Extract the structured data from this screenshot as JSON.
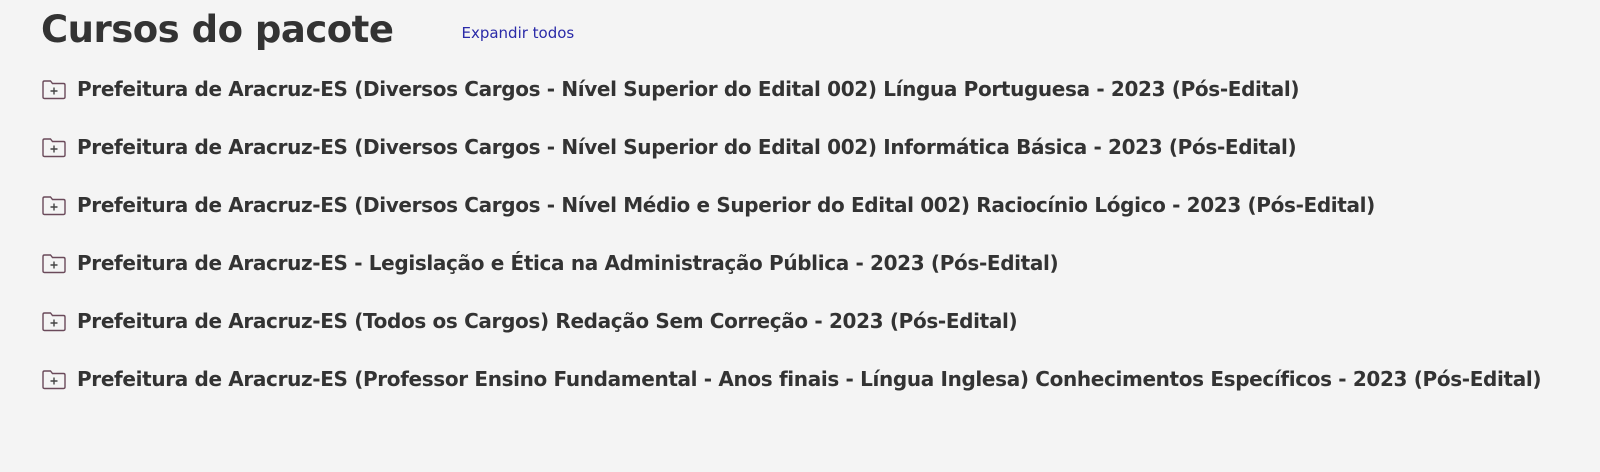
{
  "header": {
    "title": "Cursos do pacote",
    "expand_all_label": "Expandir todos"
  },
  "icons": {
    "folder": "folder-plus-icon"
  },
  "colors": {
    "background": "#f4f4f4",
    "text": "#333333",
    "link": "#2a2aa8",
    "icon_stroke": "#6a4a5a"
  },
  "courses": [
    {
      "title": "Prefeitura de Aracruz-ES (Diversos Cargos - Nível Superior do Edital 002) Língua Portuguesa - 2023 (Pós-Edital)"
    },
    {
      "title": "Prefeitura de Aracruz-ES (Diversos Cargos - Nível Superior do Edital 002) Informática Básica - 2023 (Pós-Edital)"
    },
    {
      "title": "Prefeitura de Aracruz-ES (Diversos Cargos - Nível Médio e Superior do Edital 002) Raciocínio Lógico - 2023 (Pós-Edital)"
    },
    {
      "title": "Prefeitura de Aracruz-ES - Legislação e Ética na Administração Pública - 2023 (Pós-Edital)"
    },
    {
      "title": "Prefeitura de Aracruz-ES (Todos os Cargos) Redação Sem Correção - 2023 (Pós-Edital)"
    },
    {
      "title": "Prefeitura de Aracruz-ES (Professor Ensino Fundamental - Anos finais - Língua Inglesa) Conhecimentos Específicos - 2023 (Pós-Edital)"
    }
  ]
}
